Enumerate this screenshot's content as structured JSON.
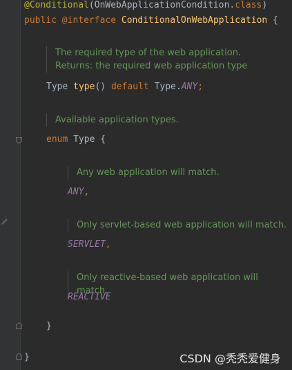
{
  "editor": {
    "line1": {
      "at": "@",
      "annotation": "Conditional",
      "open": "(",
      "arg_class": "OnWebApplicationCondition",
      "dot": ".",
      "arg_kw": "class",
      "close": ")"
    },
    "line2": {
      "public": "public",
      "annotation_kw": "@interface",
      "name": "ConditionalOnWebApplication",
      "brace": " {"
    },
    "doc1": {
      "line1": "The required type of the web application.",
      "line2": "Returns: the required web application type"
    },
    "type_decl": {
      "type": "Type",
      "method": "type",
      "parens": "()",
      "default_kw": "default",
      "enum_ref": "Type",
      "dot": ".",
      "value": "ANY",
      "semi": ";"
    },
    "doc2": {
      "line1": "Available application types."
    },
    "enum_line": {
      "kw": "enum",
      "name": "Type",
      "brace": " {"
    },
    "doc_any": {
      "line1": "Any web application will match."
    },
    "const_any": {
      "name": "ANY",
      "comma": ","
    },
    "doc_servlet": {
      "line1": "Only servlet-based web application will match."
    },
    "const_servlet": {
      "name": "SERVLET",
      "comma": ","
    },
    "doc_reactive": {
      "line1": "Only reactive-based web application will match."
    },
    "const_reactive": {
      "name": "REACTIVE"
    },
    "enum_close": "}",
    "iface_close": "}"
  },
  "watermark": "CSDN @秃秃爱健身",
  "colors": {
    "background": "#2b2b2b",
    "keyword": "#cc7832",
    "annotation": "#bbb529",
    "method": "#ffc66d",
    "constant": "#9876aa",
    "doc_comment": "#629755",
    "text": "#a9b7c6"
  }
}
